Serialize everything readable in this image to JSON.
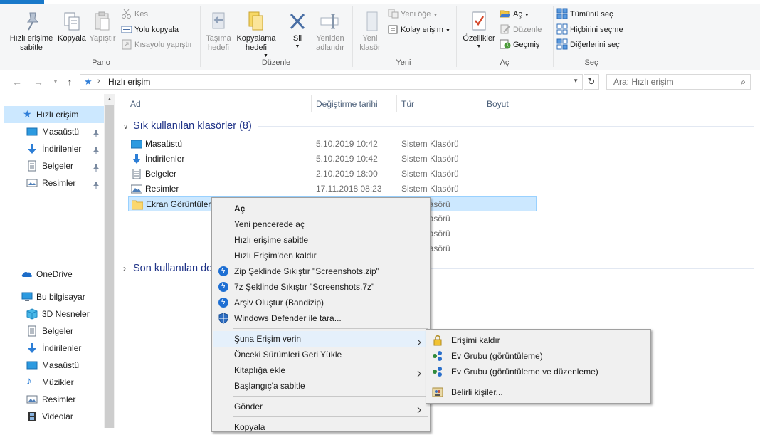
{
  "ribbon": {
    "pano": {
      "label": "Pano",
      "pin_label": "Hızlı erişime sabitle",
      "copy_label": "Kopyala",
      "paste_label": "Yapıştır",
      "cut_label": "Kes",
      "copy_path_label": "Yolu kopyala",
      "paste_shortcut_label": "Kısayolu yapıştır"
    },
    "duzenle": {
      "label": "Düzenle",
      "move_label": "Taşıma hedefi",
      "copyto_label": "Kopyalama hedefi",
      "delete_label": "Sil",
      "rename_label": "Yeniden adlandır"
    },
    "yeni": {
      "label": "Yeni",
      "new_folder_label": "Yeni klasör",
      "new_item_label": "Yeni öğe",
      "easy_access_label": "Kolay erişim"
    },
    "ac": {
      "label": "Aç",
      "properties_label": "Özellikler",
      "open_label": "Aç",
      "edit_label": "Düzenle",
      "history_label": "Geçmiş"
    },
    "sec": {
      "label": "Seç",
      "select_all_label": "Tümünü seç",
      "select_none_label": "Hiçbirini seçme",
      "invert_label": "Diğerlerini seç"
    }
  },
  "address": {
    "path": "Hızlı erişim",
    "search_placeholder": "Ara: Hızlı erişim"
  },
  "nav": {
    "quick_access": "Hızlı erişim",
    "qa_items": [
      "Masaüstü",
      "İndirilenler",
      "Belgeler",
      "Resimler"
    ],
    "onedrive": "OneDrive",
    "this_pc": "Bu bilgisayar",
    "pc_items": [
      "3D Nesneler",
      "Belgeler",
      "İndirilenler",
      "Masaüstü",
      "Müzikler",
      "Resimler",
      "Videolar"
    ]
  },
  "columns": {
    "name": "Ad",
    "date": "Değiştirme tarihi",
    "type": "Tür",
    "size": "Boyut"
  },
  "groups": {
    "frequent": "Sık kullanılan klasörler (8)",
    "recent": "Son kullanılan do"
  },
  "files": [
    {
      "name": "Masaüstü",
      "date": "5.10.2019 10:42",
      "type": "Sistem Klasörü"
    },
    {
      "name": "İndirilenler",
      "date": "5.10.2019 10:42",
      "type": "Sistem Klasörü"
    },
    {
      "name": "Belgeler",
      "date": "2.10.2019 18:00",
      "type": "Sistem Klasörü"
    },
    {
      "name": "Resimler",
      "date": "17.11.2018 08:23",
      "type": "Sistem Klasörü"
    },
    {
      "name": "Ekran Görüntüleri",
      "date": "",
      "type": "lasörü"
    },
    {
      "name": "",
      "date": "",
      "type": "lasörü"
    },
    {
      "name": "",
      "date": "",
      "type": "lasörü"
    },
    {
      "name": "",
      "date": "",
      "type": "lasörü"
    }
  ],
  "context_menu": [
    {
      "label": "Aç"
    },
    {
      "label": "Yeni pencerede aç"
    },
    {
      "label": "Hızlı erişime sabitle"
    },
    {
      "label": "Hızlı Erişim'den kaldır"
    },
    {
      "label": "Zip Şeklinde Sıkıştır \"Screenshots.zip\""
    },
    {
      "label": "7z Şeklinde Sıkıştır \"Screenshots.7z\""
    },
    {
      "label": "Arşiv Oluştur (Bandizip)"
    },
    {
      "label": "Windows Defender ile tara..."
    },
    {
      "label": "Şuna Erişim verin"
    },
    {
      "label": "Önceki Sürümleri Geri Yükle"
    },
    {
      "label": "Kitaplığa ekle"
    },
    {
      "label": "Başlangıç'a sabitle"
    },
    {
      "label": "Gönder"
    },
    {
      "label": "Kopyala"
    }
  ],
  "submenu": [
    {
      "label": "Erişimi kaldır"
    },
    {
      "label": "Ev Grubu (görüntüleme)"
    },
    {
      "label": "Ev Grubu (görüntüleme ve düzenleme)"
    },
    {
      "label": "Belirli kişiler..."
    }
  ],
  "colors": {
    "accent": "#1979ca",
    "selection": "#cce8ff",
    "group_header": "#1e3287",
    "menu_bg": "#f0f0f0"
  }
}
